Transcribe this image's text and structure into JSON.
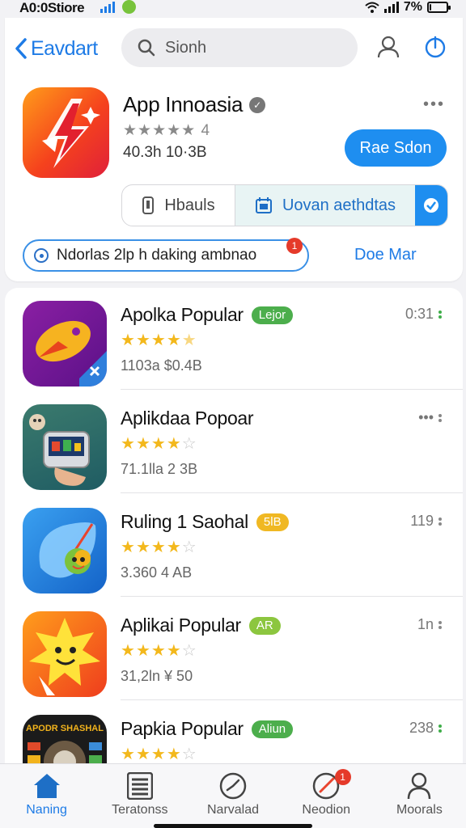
{
  "status_bar": {
    "carrier": "A0:0Stiore",
    "battery_pct": "7%",
    "battery_level": 0.07
  },
  "nav": {
    "back_label": "Eavdart",
    "search_placeholder": "Sionh"
  },
  "app": {
    "name": "App Innoasia",
    "rating_text": "★★★★★ 4",
    "meta": "40.3h 10·3B",
    "primary_action": "Rae Sdon",
    "more_icon": "more-horizontal-icon"
  },
  "segments": {
    "first_label": "Hbauls",
    "second_label": "Uovan aethdtas"
  },
  "notice": {
    "text": "Ndorlas 2lp h daking ambnao",
    "badge": "1",
    "more_link": "Doe Mar"
  },
  "list": [
    {
      "title": "Apolka Popular",
      "tag": "Lejor",
      "tag_color": "#4cae4c",
      "rating": 4.5,
      "meta": "1103a $0.4B",
      "right": "0:31",
      "dot_color": "#3fae49"
    },
    {
      "title": "Aplikdaa Popoar",
      "tag": "",
      "tag_color": "",
      "rating": 4,
      "meta": "71.1lla 2 3B",
      "right": "•••",
      "dot_color": "#888888"
    },
    {
      "title": "Ruling 1 Saohal",
      "tag": "5lB",
      "tag_color": "#f0b823",
      "rating": 4,
      "meta": "3.360 4 AB",
      "right": "119",
      "dot_color": "#888888"
    },
    {
      "title": "Aplikai Popular",
      "tag": "AR",
      "tag_color": "#8cc63f",
      "rating": 4,
      "meta": "31,2ln ¥ 50",
      "right": "1n",
      "dot_color": "#888888"
    },
    {
      "title": "Papkia Popular",
      "tag": "Aliun",
      "tag_color": "#4cae4c",
      "rating": 4,
      "meta": "",
      "right": "238",
      "dot_color": "#3fae49"
    }
  ],
  "list_icon_label": "APODR SHASHAL",
  "tabs": [
    {
      "label": "Naning",
      "icon": "home-icon"
    },
    {
      "label": "Teratonss",
      "icon": "list-icon"
    },
    {
      "label": "Narvalad",
      "icon": "compass-icon"
    },
    {
      "label": "Neodion",
      "icon": "explore-icon",
      "badge": "1"
    },
    {
      "label": "Moorals",
      "icon": "person-icon"
    }
  ]
}
